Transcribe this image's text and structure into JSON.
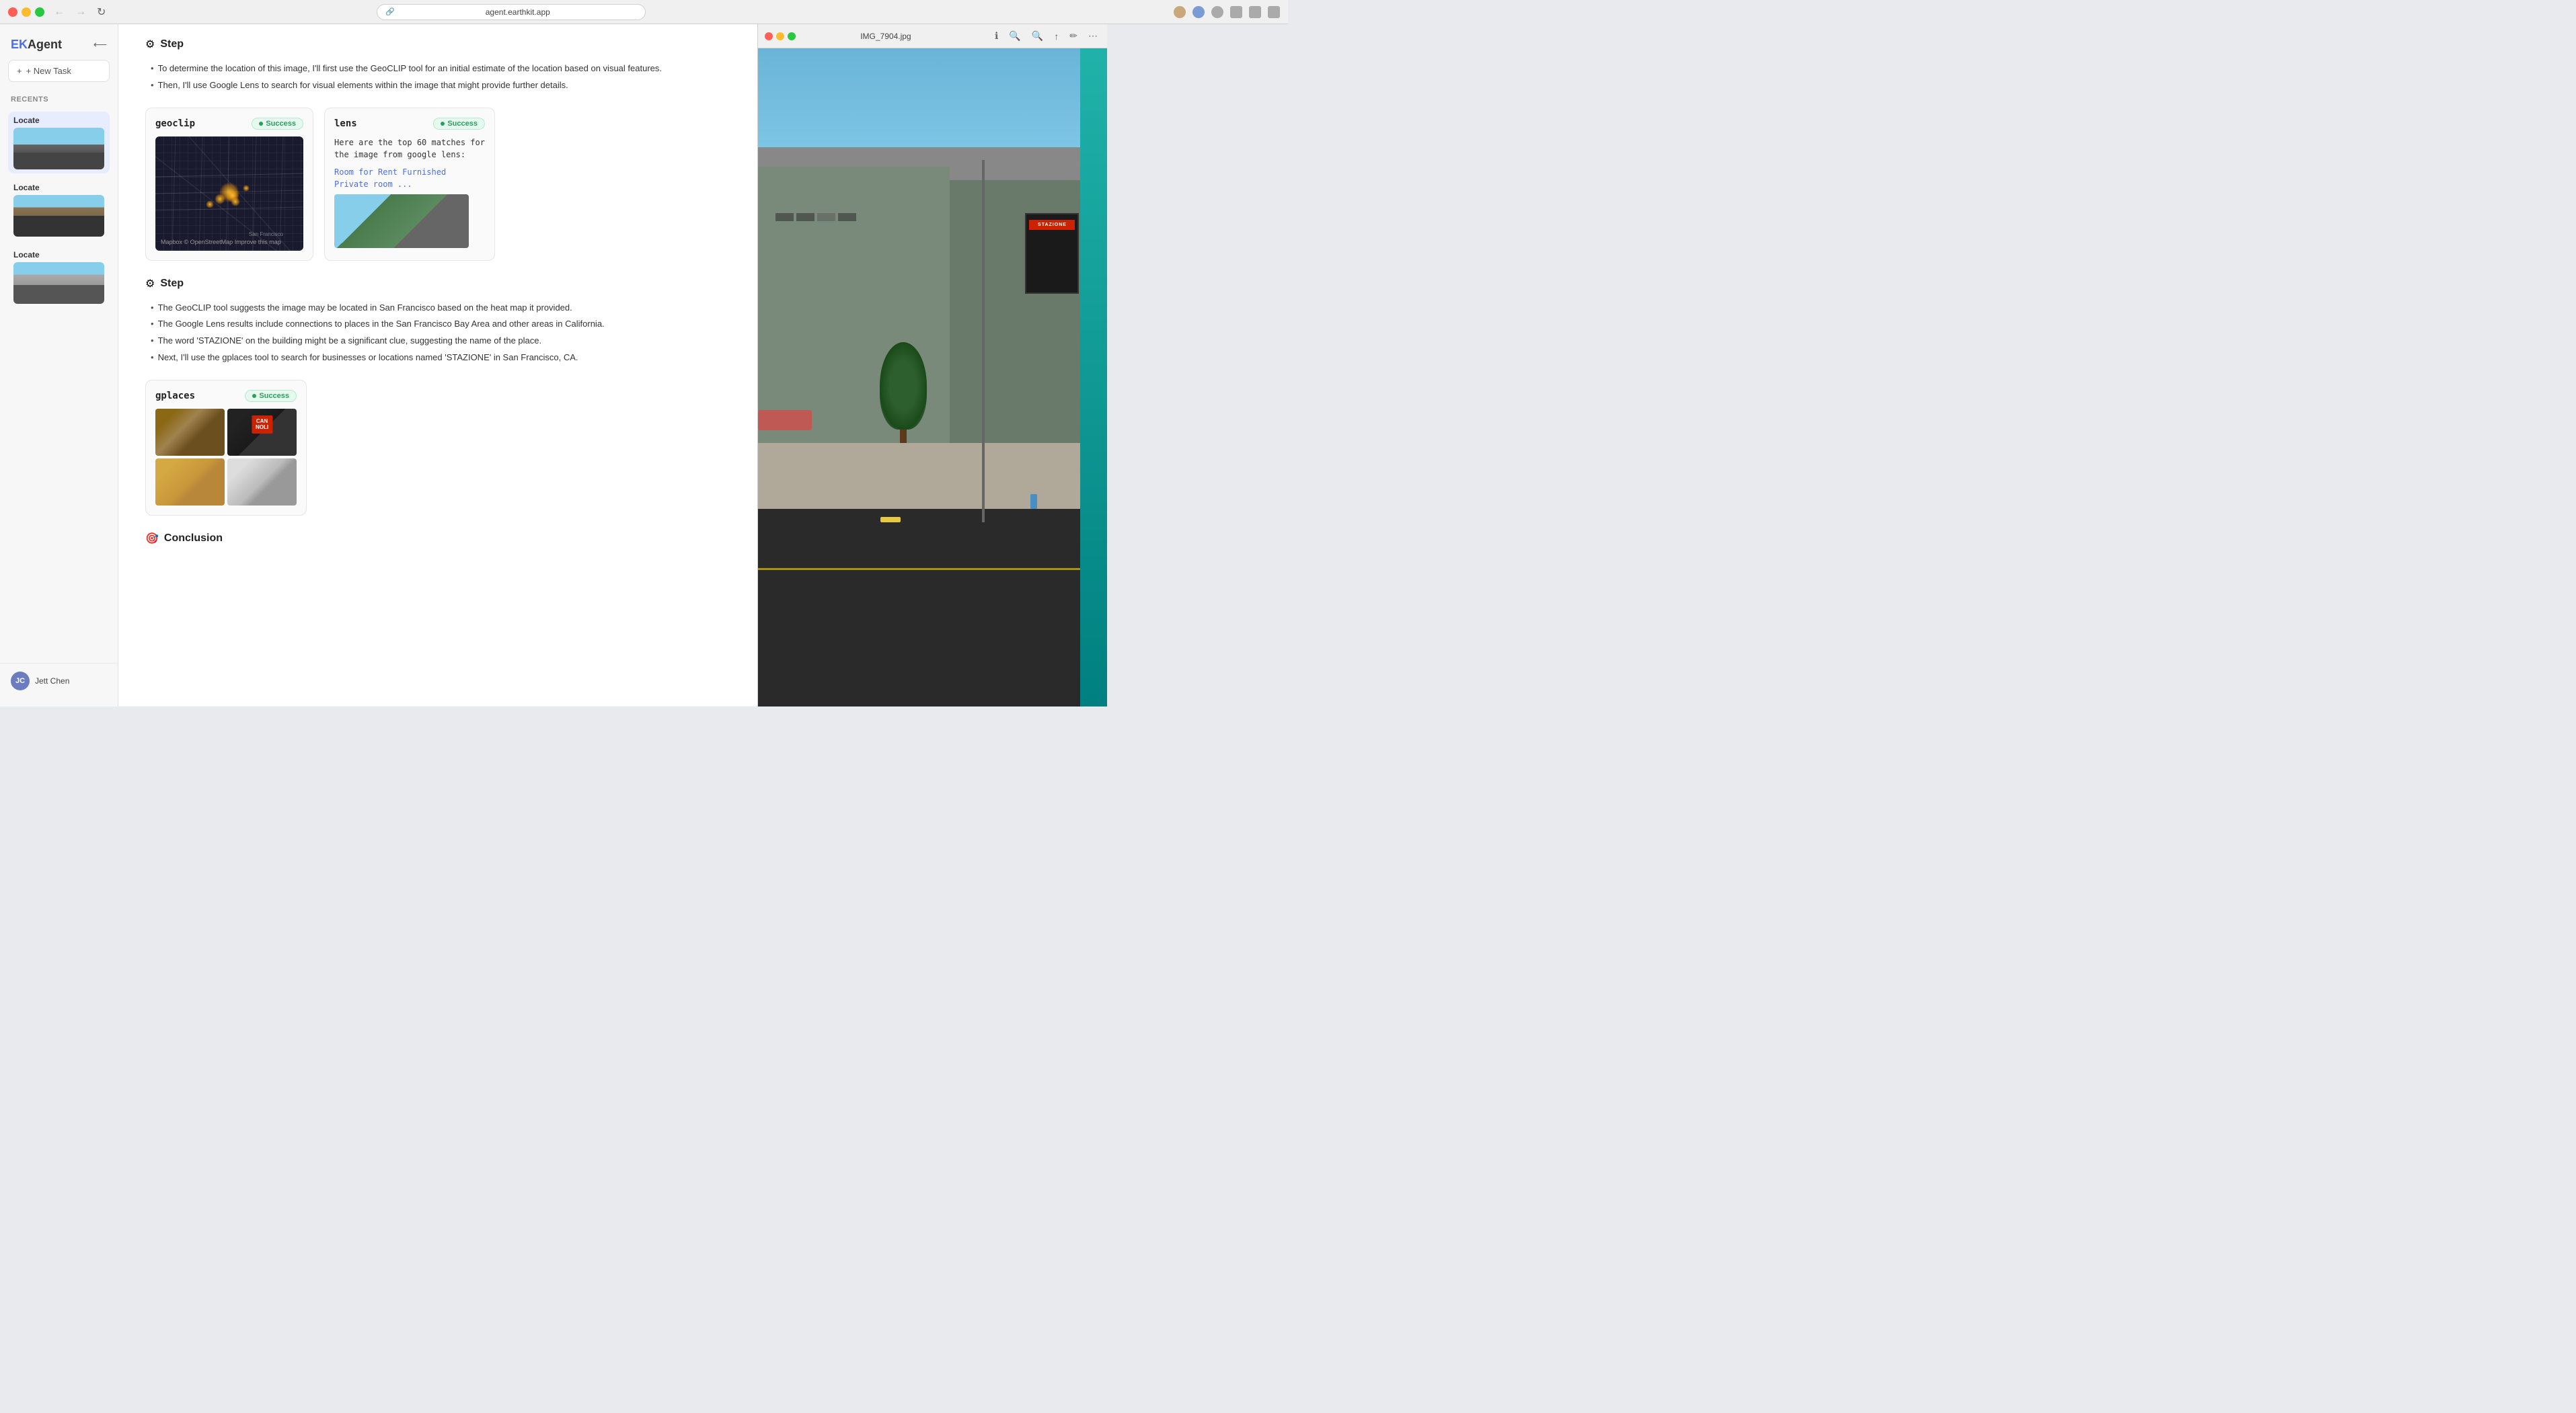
{
  "browser": {
    "url": "agent.earthkit.app",
    "title": "agent.earthkit.app"
  },
  "sidebar": {
    "logo": "EKAgent",
    "logo_ek": "EK",
    "logo_agent": "Agent",
    "new_task_label": "+ New Task",
    "recents_label": "Recents",
    "items": [
      {
        "label": "Locate",
        "active": true
      },
      {
        "label": "Locate",
        "active": false
      },
      {
        "label": "Locate",
        "active": false
      }
    ],
    "user": {
      "name": "Jett Chen",
      "initials": "JC"
    }
  },
  "main": {
    "step1": {
      "title": "Step",
      "bullets": [
        "To determine the location of this image, I'll first use the GeoCLIP tool for an initial estimate of the location based on visual features.",
        "Then, I'll use Google Lens to search for visual elements within the image that might provide further details."
      ]
    },
    "geoclip": {
      "name": "geoclip",
      "status": "Success",
      "map_label": "Mapbox © OpenStreetMap Improve this map"
    },
    "lens": {
      "name": "lens",
      "status": "Success",
      "intro_text": "Here are the top 60 matches for\nthe image from google lens:",
      "link_text": "Room for Rent Furnished\nPrivate room ..."
    },
    "step2": {
      "title": "Step",
      "bullets": [
        "The GeoCLIP tool suggests the image may be located in San Francisco based on the heat map it provided.",
        "The Google Lens results include connections to places in the San Francisco Bay Area and other areas in California.",
        "The word 'STAZIONE' on the building might be a significant clue, suggesting the name of the place.",
        "Next, I'll use the gplaces tool to search for businesses or locations named 'STAZIONE' in San Francisco, CA."
      ]
    },
    "gplaces": {
      "name": "gplaces",
      "status": "Success"
    },
    "conclusion": {
      "title": "Conclusion",
      "icon": "🎯"
    }
  },
  "image_viewer": {
    "title": "IMG_7904.jpg",
    "filename": "IMG_7904.jpg"
  },
  "nav": {
    "back": "←",
    "forward": "→",
    "reload": "↻"
  },
  "icons": {
    "step_icon": "⚙",
    "link_icon": "🔗",
    "new_tab": "+",
    "cannoli_text": "CAN\nNOLI"
  }
}
